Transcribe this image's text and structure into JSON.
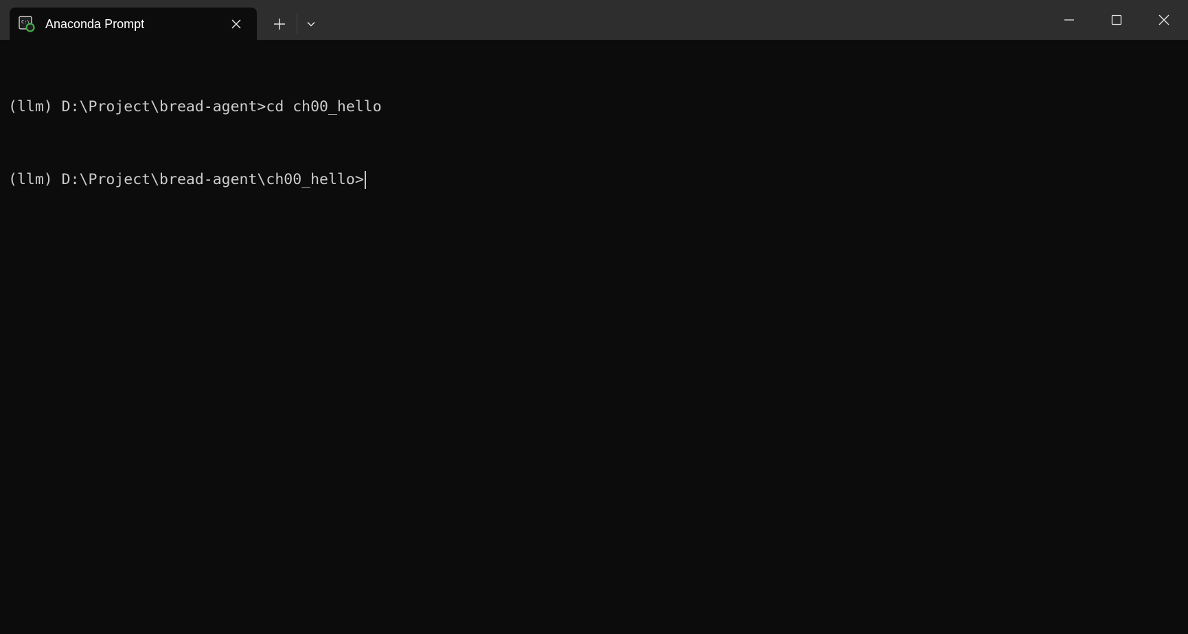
{
  "window": {
    "colors": {
      "titlebar": "#2e2e2e",
      "background": "#0c0c0c",
      "text": "#cccccc",
      "tab_title": "#ffffff"
    }
  },
  "tab": {
    "title": "Anaconda Prompt",
    "icon": "terminal-icon",
    "close_icon": "close-icon"
  },
  "toolbar": {
    "new_tab_icon": "plus-icon",
    "dropdown_icon": "chevron-down-icon"
  },
  "window_controls": {
    "minimize_icon": "minimize-icon",
    "maximize_icon": "maximize-icon",
    "close_icon": "close-icon"
  },
  "terminal": {
    "lines": [
      "(llm) D:\\Project\\bread-agent>cd ch00_hello",
      "(llm) D:\\Project\\bread-agent\\ch00_hello>"
    ]
  }
}
